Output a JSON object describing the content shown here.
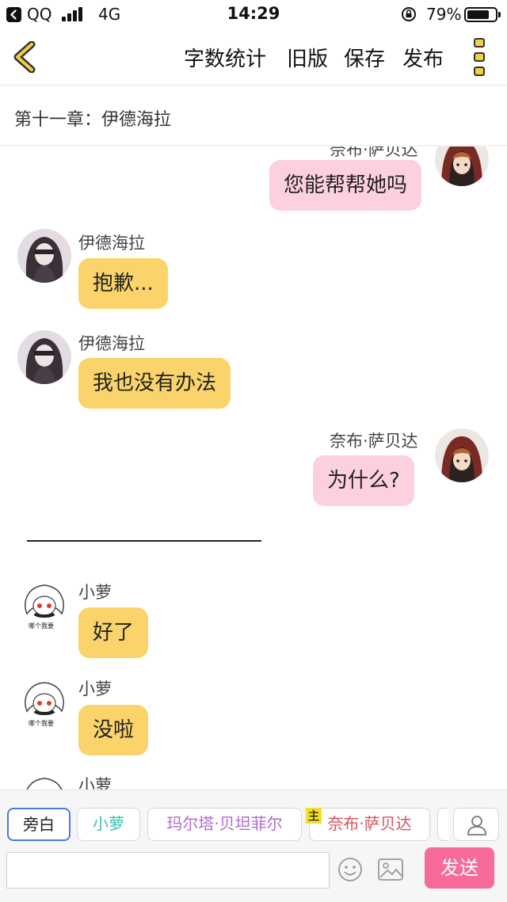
{
  "status_bar": {
    "carrier": "QQ",
    "network": "4G",
    "time": "14:29",
    "battery_percent": "79%",
    "battery_level": 0.79
  },
  "toolbar": {
    "word_count": "字数统计",
    "old_version": "旧版",
    "save": "保存",
    "publish": "发布"
  },
  "chapter": {
    "title": "第十一章：伊德海拉"
  },
  "colors": {
    "left_bubble": "#fad46b",
    "right_bubble": "#fdd0dd",
    "send_button": "#f66b9c",
    "active_chip_border": "#4a7cd8"
  },
  "messages": [
    {
      "speaker": "奈布·萨贝达",
      "text": "您能帮帮她吗",
      "side": "right",
      "avatar": "hooded-boy-avatar"
    },
    {
      "speaker": "伊德海拉",
      "text": "抱歉...",
      "side": "left",
      "avatar": "blindfold-woman-avatar"
    },
    {
      "speaker": "伊德海拉",
      "text": "我也没有办法",
      "side": "left",
      "avatar": "blindfold-woman-avatar"
    },
    {
      "speaker": "奈布·萨贝达",
      "text": "为什么?",
      "side": "right",
      "avatar": "hooded-boy-avatar"
    },
    {
      "speaker": "小萝",
      "text": "好了",
      "side": "left",
      "avatar": "chibi-girl-avatar",
      "avatar_caption": "哪个我要"
    },
    {
      "speaker": "小萝",
      "text": "没啦",
      "side": "left",
      "avatar": "chibi-girl-avatar",
      "avatar_caption": "哪个我要"
    },
    {
      "speaker": "小萝",
      "text": "",
      "side": "left",
      "avatar": "chibi-girl-avatar"
    }
  ],
  "characters": [
    {
      "label": "旁白",
      "color": "#222222",
      "active": true
    },
    {
      "label": "小萝",
      "color": "#3bbfb0",
      "active": false
    },
    {
      "label": "玛尔塔·贝坦菲尔",
      "color": "#b06ad0",
      "active": false
    },
    {
      "label": "奈布·萨贝达",
      "color": "#e0505a",
      "active": false,
      "badge": "主"
    }
  ],
  "composer": {
    "input_value": "",
    "send_label": "发送"
  }
}
